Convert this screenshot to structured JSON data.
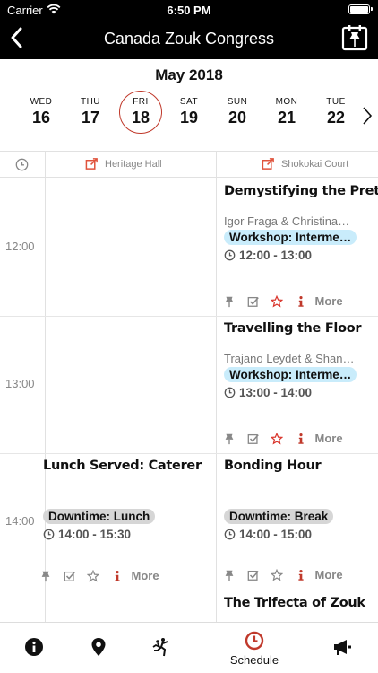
{
  "status_bar": {
    "carrier": "Carrier",
    "time": "6:50 PM"
  },
  "nav": {
    "title": "Canada Zouk Congress"
  },
  "calendar": {
    "month": "May 2018",
    "days": [
      {
        "dow": "WED",
        "num": "16"
      },
      {
        "dow": "THU",
        "num": "17"
      },
      {
        "dow": "FRI",
        "num": "18",
        "selected": true
      },
      {
        "dow": "SAT",
        "num": "19"
      },
      {
        "dow": "SUN",
        "num": "20"
      },
      {
        "dow": "MON",
        "num": "21"
      },
      {
        "dow": "TUE",
        "num": "22"
      }
    ]
  },
  "rooms": [
    "Heritage Hall",
    "Shokokai Court"
  ],
  "hours": [
    "12:00",
    "13:00",
    "14:00"
  ],
  "events": [
    {
      "title": "Demystifying the Pretzel",
      "speaker": "Igor Fraga & Christina…",
      "tag": "Workshop: Interme…",
      "time": "12:00 - 13:00",
      "more": "More"
    },
    {
      "title": "Travelling the Floor",
      "speaker": "Trajano Leydet & Shan…",
      "tag": "Workshop: Interme…",
      "time": "13:00 - 14:00",
      "more": "More"
    },
    {
      "title": "Lunch Served: Caterer",
      "speaker": "",
      "tag": "Downtime: Lunch",
      "time": "14:00 - 15:30",
      "more": "More"
    },
    {
      "title": "Bonding Hour",
      "speaker": "",
      "tag": "Downtime: Break",
      "time": "14:00 - 15:00",
      "more": "More"
    },
    {
      "title": "The Trifecta of Zouk",
      "speaker": "",
      "tag": "",
      "time": "",
      "more": ""
    }
  ],
  "tabbar": {
    "active_label": "Schedule"
  },
  "colors": {
    "accent": "#c0392b",
    "workshop_tag": "#c9ecfb",
    "downtime_tag": "#d6d6d6",
    "nav_bg": "#000000"
  }
}
